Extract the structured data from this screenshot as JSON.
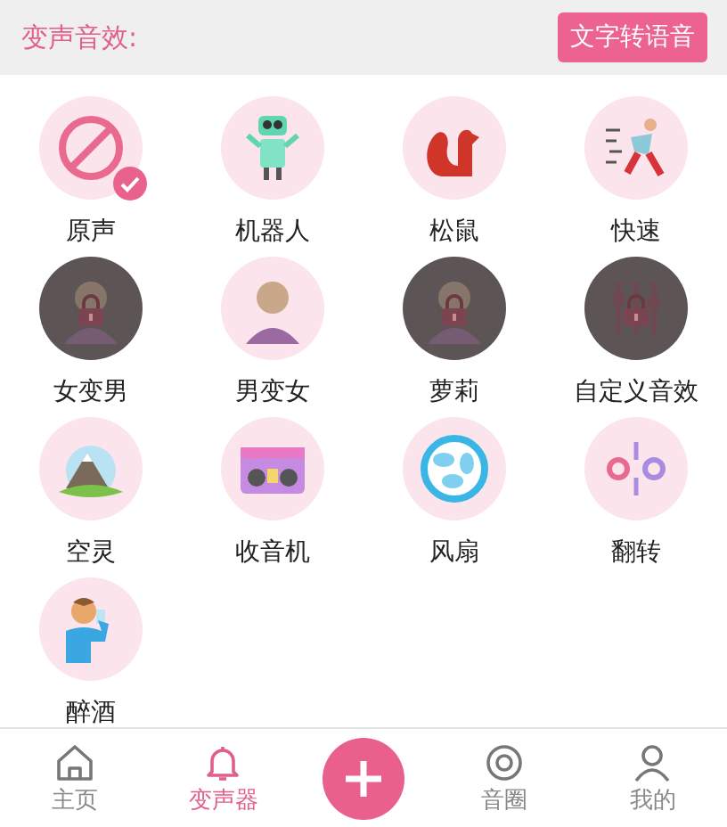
{
  "header": {
    "title": "变声音效:",
    "button": "文字转语音"
  },
  "effects": [
    {
      "label": "原声",
      "selected": true,
      "locked": false
    },
    {
      "label": "机器人",
      "selected": false,
      "locked": false
    },
    {
      "label": "松鼠",
      "selected": false,
      "locked": false
    },
    {
      "label": "快速",
      "selected": false,
      "locked": false
    },
    {
      "label": "女变男",
      "selected": false,
      "locked": true
    },
    {
      "label": "男变女",
      "selected": false,
      "locked": false
    },
    {
      "label": "萝莉",
      "selected": false,
      "locked": true
    },
    {
      "label": "自定义音效",
      "selected": false,
      "locked": true
    },
    {
      "label": "空灵",
      "selected": false,
      "locked": false
    },
    {
      "label": "收音机",
      "selected": false,
      "locked": false
    },
    {
      "label": "风扇",
      "selected": false,
      "locked": false
    },
    {
      "label": "翻转",
      "selected": false,
      "locked": false
    },
    {
      "label": "醉酒",
      "selected": false,
      "locked": false
    }
  ],
  "nav": [
    {
      "kind": "tab",
      "label": "主页",
      "selected": false
    },
    {
      "kind": "tab",
      "label": "变声器",
      "selected": true
    },
    {
      "kind": "add"
    },
    {
      "kind": "tab",
      "label": "音圈",
      "selected": false
    },
    {
      "kind": "tab",
      "label": "我的",
      "selected": false
    }
  ]
}
